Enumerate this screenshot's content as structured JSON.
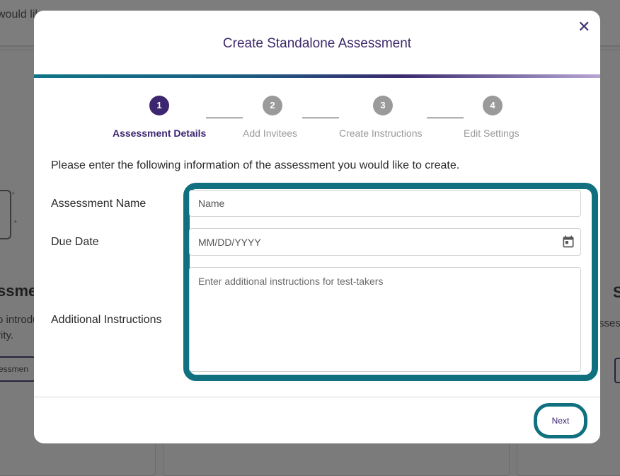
{
  "background": {
    "topbar_fragment": "would lik",
    "left_card": {
      "heading_fragment": "ssme",
      "text_line1": "o introdu",
      "text_line2": "rity.",
      "button_fragment": "sessmen"
    },
    "right_card": {
      "heading_fragment": "S",
      "text_fragment": "ssess"
    }
  },
  "modal": {
    "title": "Create Standalone Assessment",
    "close_icon": "close-icon",
    "steps": [
      {
        "number": "1",
        "label": "Assessment Details",
        "state": "active"
      },
      {
        "number": "2",
        "label": "Add Invitees",
        "state": "inactive"
      },
      {
        "number": "3",
        "label": "Create Instructions",
        "state": "inactive"
      },
      {
        "number": "4",
        "label": "Edit Settings",
        "state": "inactive"
      }
    ],
    "intro": "Please enter the following information of the assessment you would like to create.",
    "fields": {
      "name": {
        "label": "Assessment Name",
        "placeholder": "Name",
        "value": ""
      },
      "due_date": {
        "label": "Due Date",
        "placeholder": "MM/DD/YYYY",
        "value": "",
        "icon": "calendar-icon"
      },
      "instructions": {
        "label": "Additional Instructions",
        "placeholder": "Enter additional instructions for test-takers",
        "value": ""
      }
    },
    "next_label": "Next"
  },
  "colors": {
    "brand_purple": "#3d2670",
    "highlight_teal": "#11707f",
    "inactive_gray": "#9a9a9a"
  }
}
